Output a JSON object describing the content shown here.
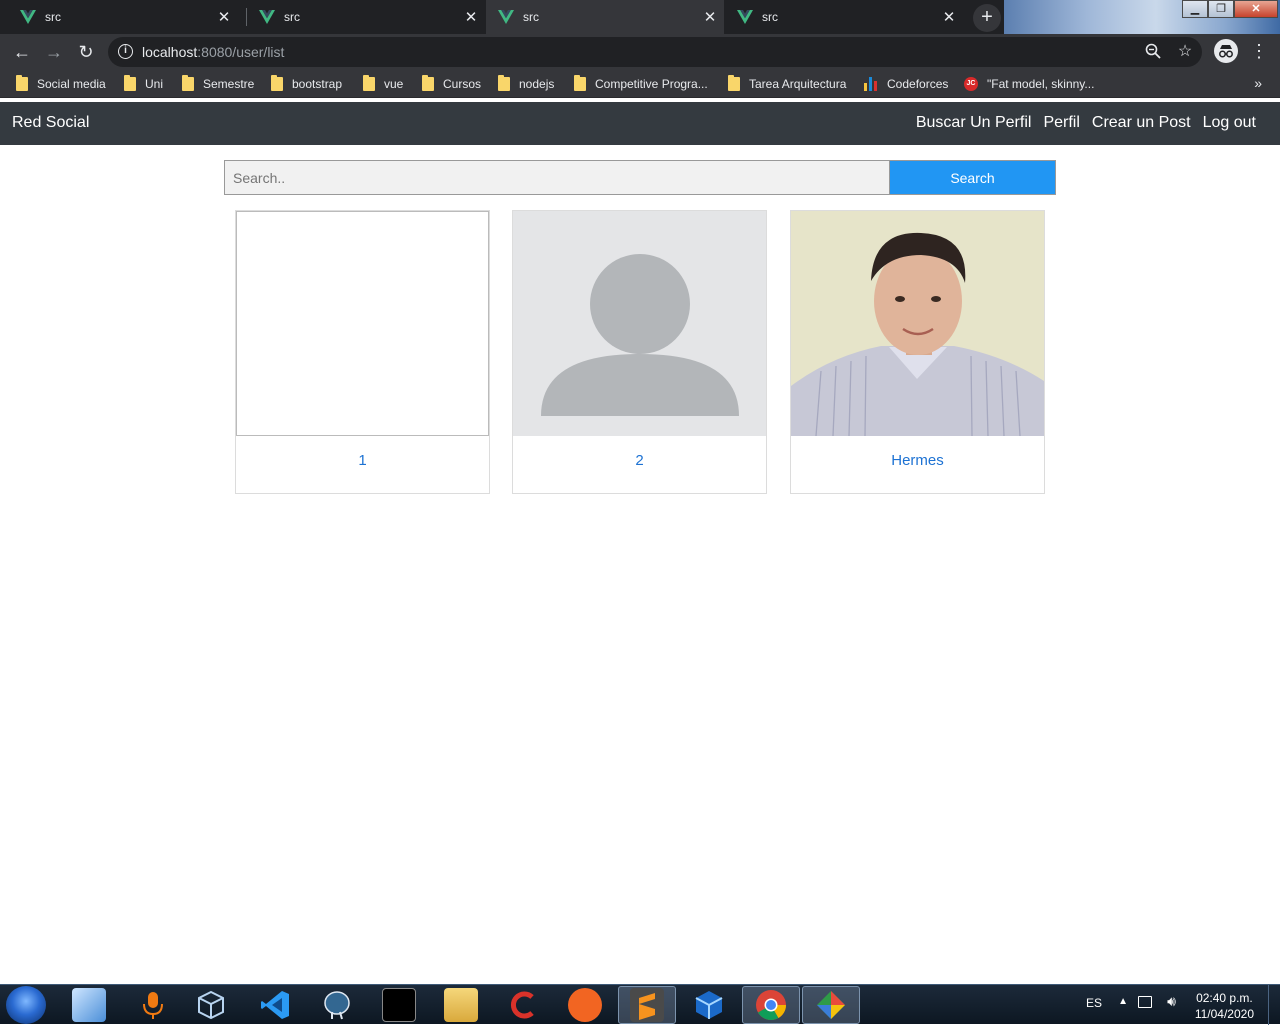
{
  "browser": {
    "tabs": [
      {
        "title": "src",
        "active": false
      },
      {
        "title": "src",
        "active": false
      },
      {
        "title": "src",
        "active": true
      },
      {
        "title": "src",
        "active": false
      }
    ],
    "address": {
      "host": "localhost",
      "rest": ":8080/user/list"
    },
    "bookmarks": [
      {
        "label": "Social media",
        "icon": "folder-icon"
      },
      {
        "label": "Uni",
        "icon": "folder-icon"
      },
      {
        "label": "Semestre",
        "icon": "folder-icon"
      },
      {
        "label": "bootstrap",
        "icon": "folder-icon"
      },
      {
        "label": "vue",
        "icon": "folder-icon"
      },
      {
        "label": "Cursos",
        "icon": "folder-icon"
      },
      {
        "label": "nodejs",
        "icon": "folder-icon"
      },
      {
        "label": "Competitive Progra...",
        "icon": "folder-icon"
      },
      {
        "label": "Tarea Arquitectura",
        "icon": "folder-icon"
      },
      {
        "label": "Codeforces",
        "icon": "codeforces-icon"
      },
      {
        "label": "\"Fat model, skinny...",
        "icon": "javacodegeeks-icon"
      }
    ]
  },
  "app": {
    "brand": "Red Social",
    "nav": [
      "Buscar Un Perfil",
      "Perfil",
      "Crear un Post",
      "Log out"
    ],
    "search": {
      "placeholder": "Search..",
      "button": "Search"
    },
    "users": [
      {
        "name": "1",
        "picture": "empty"
      },
      {
        "name": "2",
        "picture": "default-avatar"
      },
      {
        "name": "Hermes",
        "picture": "photo"
      }
    ]
  },
  "taskbar": {
    "language": "ES",
    "time": "02:40 p.m.",
    "date": "11/04/2020"
  },
  "colors": {
    "navbar": "#343a40",
    "search_button": "#2196f3",
    "link": "#1d72d3",
    "chrome_dark": "#202124",
    "chrome_toolbar": "#35363a"
  }
}
